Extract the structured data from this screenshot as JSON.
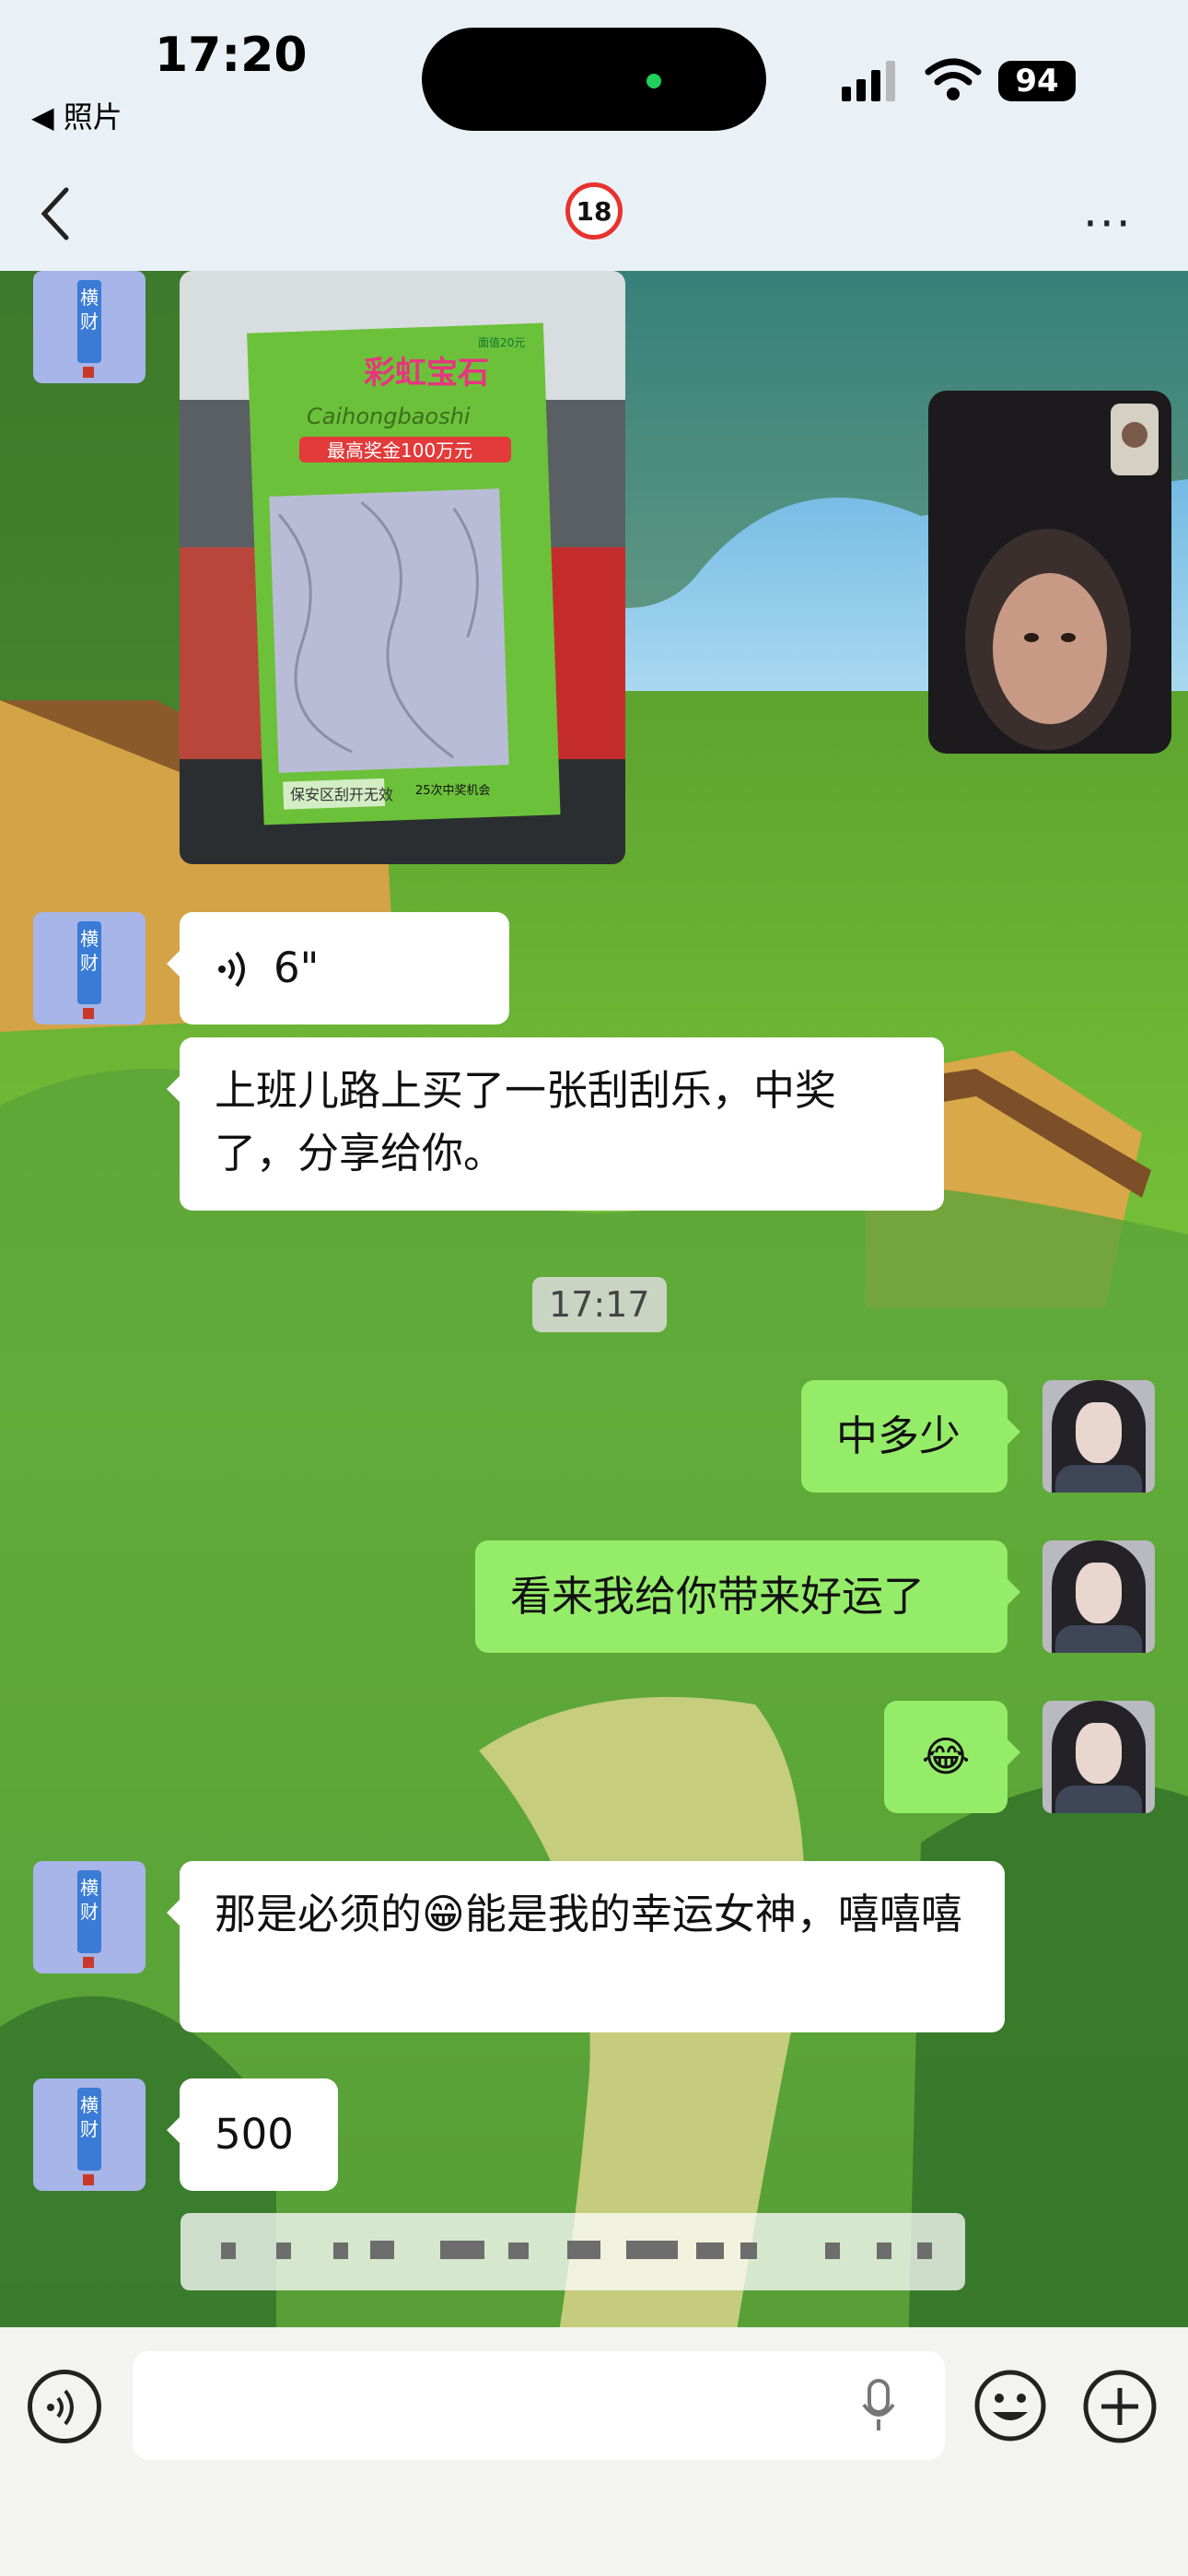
{
  "status_bar": {
    "time": "17:20",
    "back_app": "◀ 照片",
    "battery": "94"
  },
  "nav": {
    "title_badge": "18",
    "more": "···"
  },
  "messages": {
    "voice": {
      "icon": "voice-wave-icon",
      "duration": "6\""
    },
    "text1": "上班儿路上买了一张刮刮乐，中奖了，分享给你。",
    "timestamp": "17:17",
    "r1": "中多少",
    "r2": "看来我给你带来好运了",
    "r3_emoji": "😂",
    "text2": "那是必须的😁能是我的幸运女神，嘻嘻嘻",
    "text3": "500"
  },
  "ticket": {
    "brand": "彩虹宝石",
    "subtitle": "Caihongbaoshi",
    "prize": "最高奖金100万元",
    "price": "面值20元",
    "footer": "保安区刮开无效",
    "chances": "25次中奖机会"
  },
  "avatar_left": {
    "chars": "横财"
  },
  "colors": {
    "sent_bubble": "#95ec69",
    "received_bubble": "#ffffff",
    "nav_bg": "#e9f1f6"
  }
}
